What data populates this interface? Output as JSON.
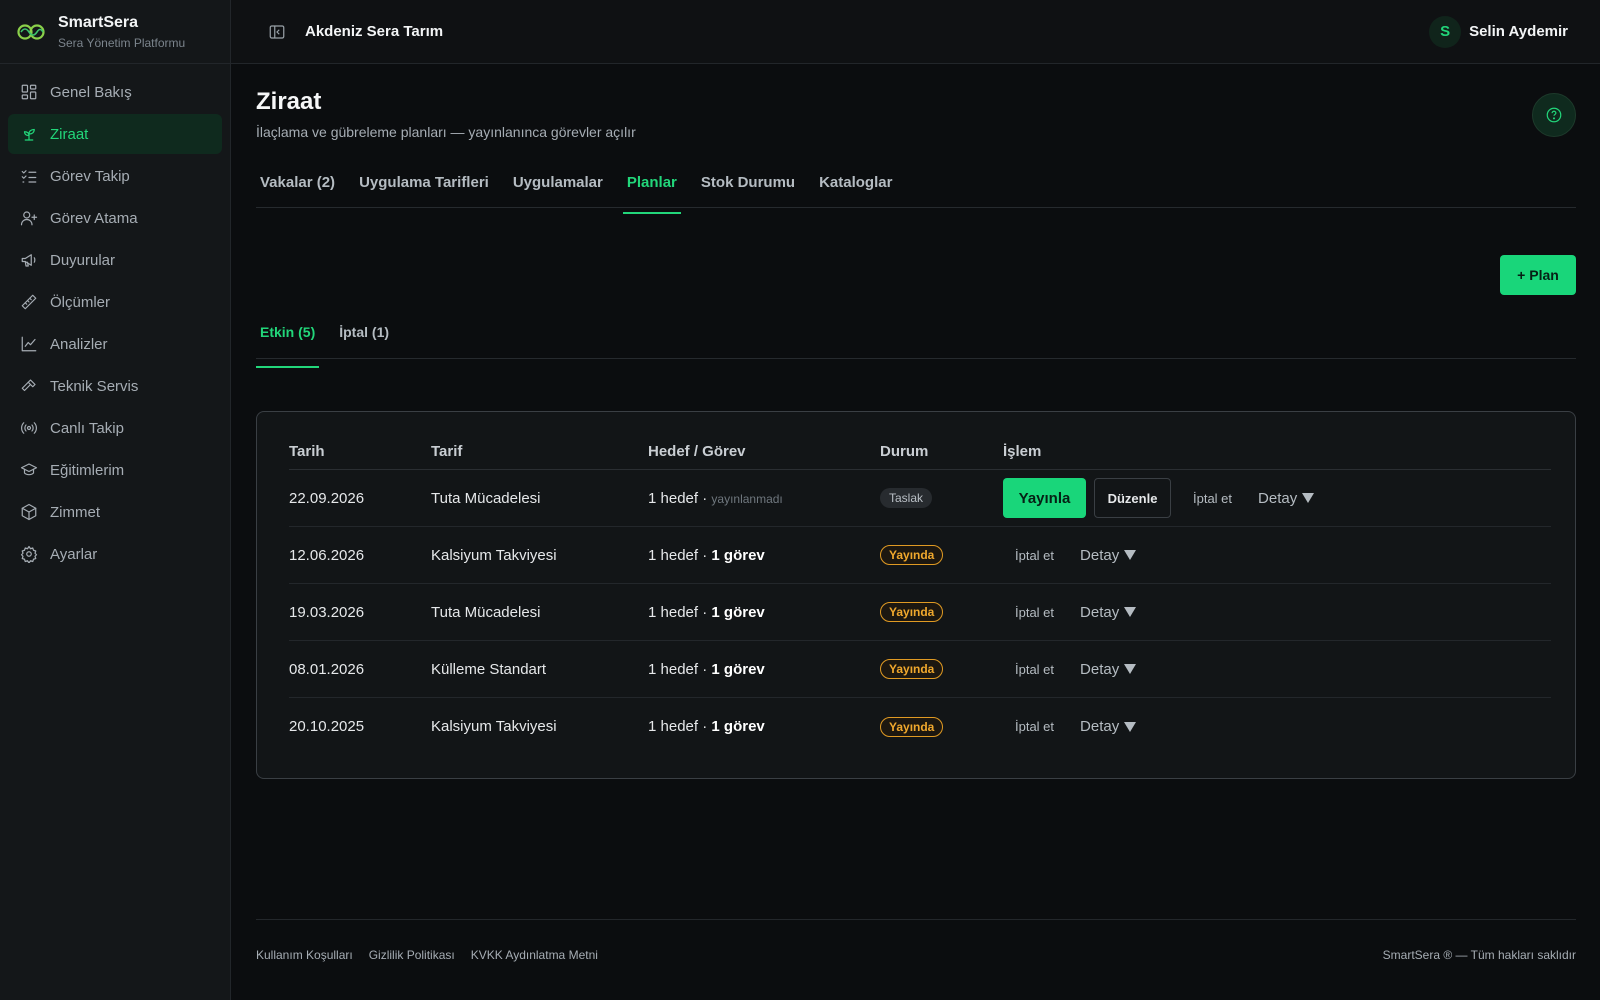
{
  "brand": {
    "name": "SmartSera",
    "subtitle": "Sera Yönetim Platformu"
  },
  "sidebar": {
    "items": [
      {
        "label": "Genel Bakış",
        "icon": "dashboard-icon"
      },
      {
        "label": "Ziraat",
        "icon": "sprout-icon",
        "active": true
      },
      {
        "label": "Görev Takip",
        "icon": "checklist-icon"
      },
      {
        "label": "Görev Atama",
        "icon": "user-plus-icon"
      },
      {
        "label": "Duyurular",
        "icon": "megaphone-icon"
      },
      {
        "label": "Ölçümler",
        "icon": "ruler-icon"
      },
      {
        "label": "Analizler",
        "icon": "chart-line-icon"
      },
      {
        "label": "Teknik Servis",
        "icon": "hammer-icon"
      },
      {
        "label": "Canlı Takip",
        "icon": "broadcast-icon"
      },
      {
        "label": "Eğitimlerim",
        "icon": "graduation-cap-icon"
      },
      {
        "label": "Zimmet",
        "icon": "box-icon"
      },
      {
        "label": "Ayarlar",
        "icon": "gear-icon"
      }
    ]
  },
  "header": {
    "org": "Akdeniz Sera Tarım",
    "user_initial": "S",
    "user_name": "Selin Aydemir"
  },
  "page": {
    "title": "Ziraat",
    "subtitle": "İlaçlama ve gübreleme planları — yayınlanınca görevler açılır"
  },
  "tabs": [
    {
      "label": "Vakalar (2)"
    },
    {
      "label": "Uygulama Tarifleri"
    },
    {
      "label": "Uygulamalar"
    },
    {
      "label": "Planlar",
      "active": true
    },
    {
      "label": "Stok Durumu"
    },
    {
      "label": "Kataloglar"
    }
  ],
  "add_plan_label": "+ Plan",
  "subtabs": [
    {
      "label": "Etkin (5)",
      "active": true
    },
    {
      "label": "İptal (1)"
    }
  ],
  "table": {
    "headers": [
      "Tarih",
      "Tarif",
      "Hedef / Görev",
      "Durum",
      "İşlem"
    ],
    "rows": [
      {
        "date": "22.09.2026",
        "recipe": "Tuta Mücadelesi",
        "target": "1 hedef",
        "sep": " · ",
        "task": "yayınlanmadı",
        "status": "Taslak",
        "draft": true
      },
      {
        "date": "12.06.2026",
        "recipe": "Kalsiyum Takviyesi",
        "target": "1 hedef",
        "sep": " · ",
        "task": "1 görev",
        "status": "Yayında"
      },
      {
        "date": "19.03.2026",
        "recipe": "Tuta Mücadelesi",
        "target": "1 hedef",
        "sep": " · ",
        "task": "1 görev",
        "status": "Yayında"
      },
      {
        "date": "08.01.2026",
        "recipe": "Külleme Standart",
        "target": "1 hedef",
        "sep": " · ",
        "task": "1 görev",
        "status": "Yayında"
      },
      {
        "date": "20.10.2025",
        "recipe": "Kalsiyum Takviyesi",
        "target": "1 hedef",
        "sep": " · ",
        "task": "1 görev",
        "status": "Yayında"
      }
    ],
    "actions": {
      "publish": "Yayınla",
      "edit": "Düzenle",
      "cancel": "İptal et",
      "detail": "Detay"
    }
  },
  "footer": {
    "links": [
      "Kullanım Koşulları",
      "Gizlilik Politikası",
      "KVKK Aydınlatma Metni"
    ],
    "copyright": "SmartSera ® — Tüm hakları saklıdır"
  },
  "colors": {
    "accent": "#22d67a",
    "warning": "#f0a82d",
    "background": "#0b0d0f"
  }
}
